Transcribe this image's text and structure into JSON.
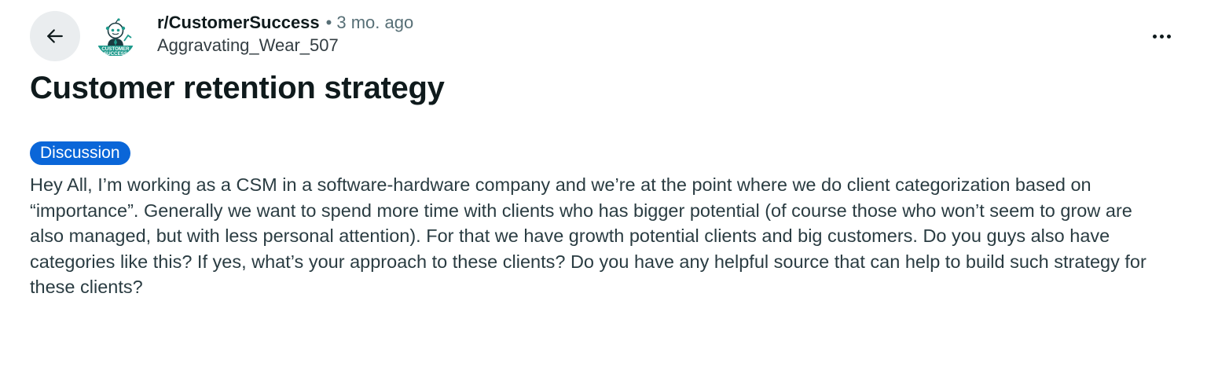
{
  "post": {
    "subreddit": "r/CustomerSuccess",
    "separator": "•",
    "time_ago": "3 mo. ago",
    "author": "Aggravating_Wear_507",
    "title": "Customer retention strategy",
    "flair": "Discussion",
    "body": "Hey All, I’m working as a CSM in a software-hardware company and we’re at the point where we do client categorization based on “importance”. Generally we want to spend more time with clients who has bigger potential (of course those who won’t seem to grow are also managed, but with less personal attention). For that we have growth potential clients and big customers. Do you guys also have categories like this? If yes, what’s your approach to these clients? Do you have any helpful source that can help to build such strategy for these clients?"
  },
  "avatar": {
    "text_line1": "CUSTOMER",
    "text_line2": "SUCCESS"
  },
  "icons": {
    "back": "arrow-left-icon",
    "more": "more-horizontal-icon"
  },
  "colors": {
    "flair_bg": "#0a66d8",
    "back_button_bg": "#eaedef",
    "meta_gray": "#576f76",
    "avatar_teal": "#1e9a8c"
  }
}
